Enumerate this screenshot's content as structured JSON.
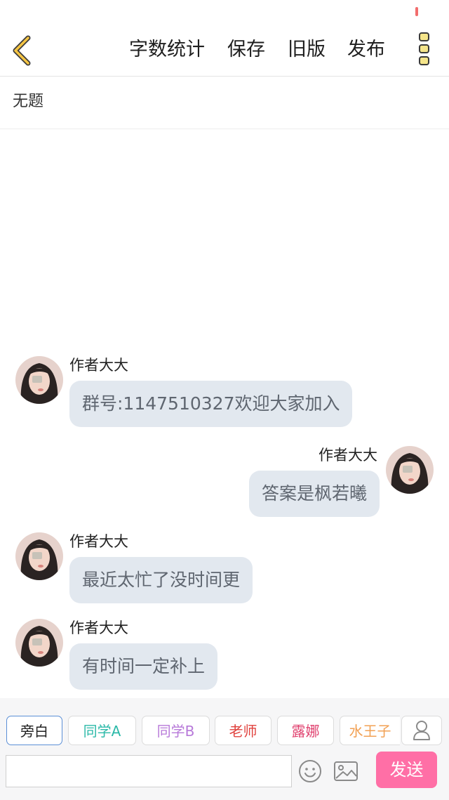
{
  "header": {
    "actions": {
      "word_count": "字数统计",
      "save": "保存",
      "old_version": "旧版",
      "publish": "发布"
    }
  },
  "story": {
    "title": "无题"
  },
  "messages": [
    {
      "sender": "作者大大",
      "text": "群号:1147510327欢迎大家加入",
      "side": "left"
    },
    {
      "sender": "作者大大",
      "text": "答案是枫若曦",
      "side": "right"
    },
    {
      "sender": "作者大大",
      "text": "最近太忙了没时间更",
      "side": "left"
    },
    {
      "sender": "作者大大",
      "text": "有时间一定补上",
      "side": "left"
    }
  ],
  "roles": [
    {
      "label": "旁白",
      "color": "#222222"
    },
    {
      "label": "同学A",
      "color": "#2bb9a8"
    },
    {
      "label": "同学B",
      "color": "#b779d9"
    },
    {
      "label": "老师",
      "color": "#e0403c"
    },
    {
      "label": "露娜",
      "color": "#e0406e"
    },
    {
      "label": "水王子",
      "color": "#f2a154"
    }
  ],
  "composer": {
    "placeholder": "",
    "send_label": "发送"
  },
  "icons": {
    "back": "chevron-left-icon",
    "more": "more-vertical-icon",
    "person": "person-icon",
    "emoji": "smiley-icon",
    "image": "image-icon"
  },
  "colors": {
    "accent_yellow": "#f5c543",
    "send_pink": "#ff6fa6",
    "bubble": "#e2e8ef",
    "selected_role_border": "#5b8fd6"
  }
}
